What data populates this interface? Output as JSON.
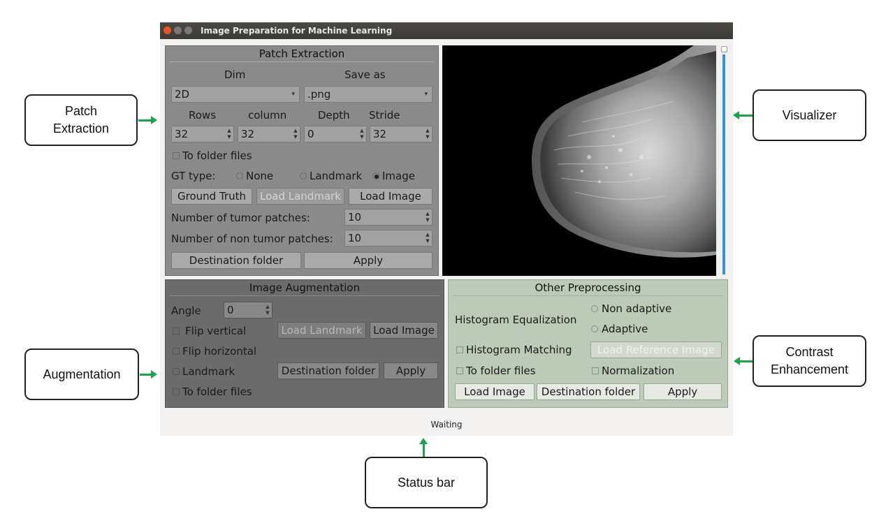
{
  "window": {
    "title": "Image Preparation for Machine Learning"
  },
  "patch": {
    "title": "Patch Extraction",
    "dim_label": "Dim",
    "save_as_label": "Save as",
    "dim_value": "2D",
    "save_as_value": ".png",
    "rows_label": "Rows",
    "column_label": "column",
    "depth_label": "Depth",
    "stride_label": "Stride",
    "rows_value": "32",
    "column_value": "32",
    "depth_value": "0",
    "stride_value": "32",
    "to_folder_files": "To folder files",
    "gt_type_label": "GT type:",
    "gt_none": "None",
    "gt_landmark": "Landmark",
    "gt_image": "Image",
    "ground_truth_btn": "Ground Truth",
    "load_landmark_btn": "Load Landmark",
    "load_image_btn": "Load Image",
    "tumor_label": "Number of tumor patches:",
    "tumor_value": "10",
    "non_tumor_label": "Number of non tumor patches:",
    "non_tumor_value": "10",
    "destination_btn": "Destination folder",
    "apply_btn": "Apply"
  },
  "augmentation": {
    "title": "Image Augmentation",
    "angle_label": "Angle",
    "angle_value": "0",
    "flip_vertical": "Flip vertical",
    "flip_horizontal": "Flip horizontal",
    "landmark": "Landmark",
    "to_folder_files": "To folder files",
    "load_landmark_btn": "Load Landmark",
    "load_image_btn": "Load Image",
    "destination_btn": "Destination folder",
    "apply_btn": "Apply"
  },
  "other": {
    "title": "Other Preprocessing",
    "hist_eq_label": "Histogram Equalization",
    "non_adaptive": "Non adaptive",
    "adaptive": "Adaptive",
    "hist_matching": "Histogram Matching",
    "load_reference_btn": "Load Reference Image",
    "to_folder_files": "To folder files",
    "normalization": "Normalization",
    "load_image_btn": "Load Image",
    "destination_btn": "Destination folder",
    "apply_btn": "Apply"
  },
  "status": {
    "text": "Waiting"
  },
  "callouts": {
    "patch": "Patch\nExtraction",
    "augmentation": "Augmentation",
    "visualizer": "Visualizer",
    "contrast": "Contrast\nEnhancement",
    "status_bar": "Status bar"
  },
  "colors": {
    "arrow": "#1aa34a",
    "scrollbar": "#3b8fd8",
    "close_button": "#e95420"
  },
  "icons": [
    "close-icon",
    "minimize-icon",
    "maximize-icon",
    "dropdown-arrow-icon",
    "spin-arrows-icon",
    "arrow-icon"
  ]
}
